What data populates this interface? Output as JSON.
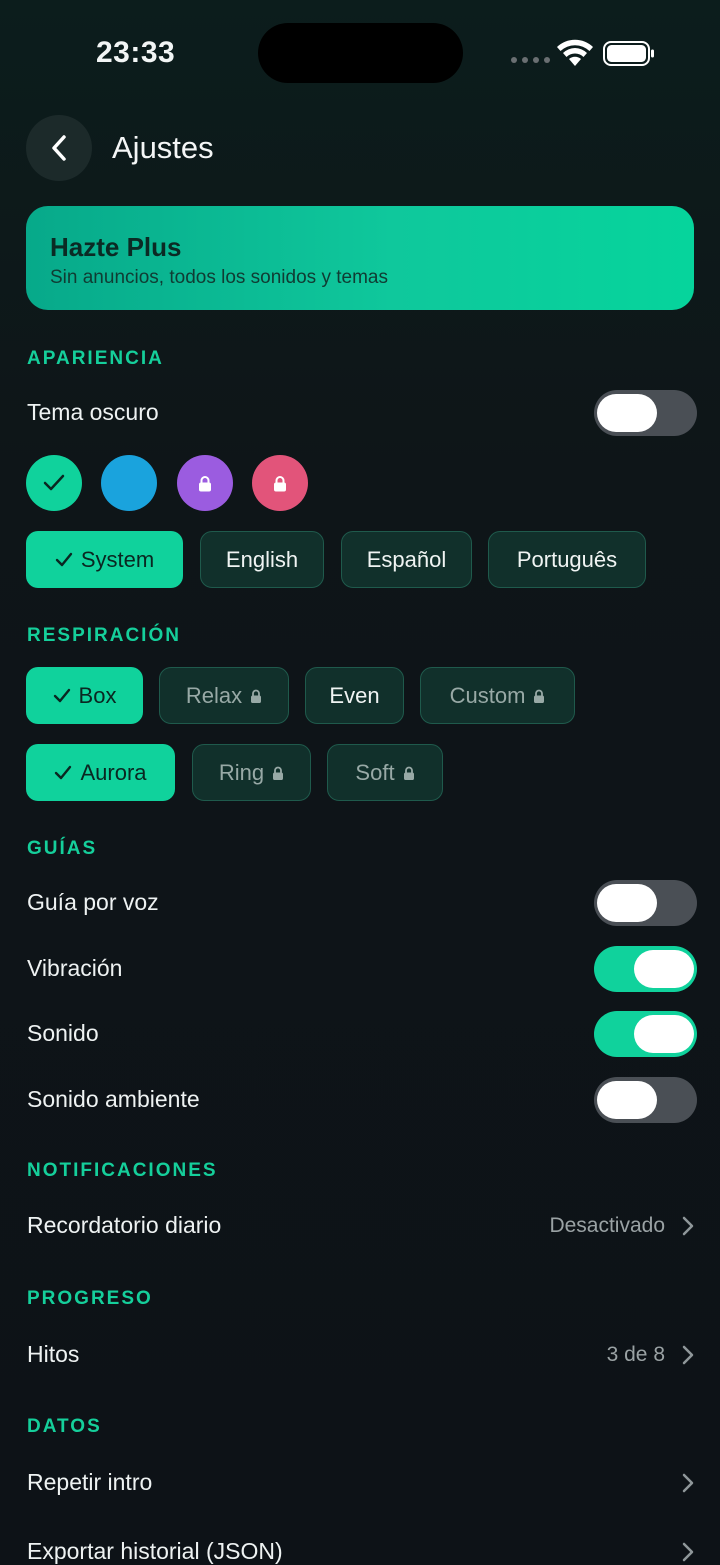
{
  "status": {
    "time": "23:33"
  },
  "header": {
    "title": "Ajustes"
  },
  "plus": {
    "title": "Hazte Plus",
    "subtitle": "Sin anuncios, todos los sonidos y temas"
  },
  "appearance": {
    "section": "APARIENCIA",
    "dark_theme_label": "Tema oscuro",
    "dark_theme_on": false,
    "swatch_colors": [
      "#10d29c",
      "#1aa3dd",
      "#9b5ce0",
      "#e2547a"
    ],
    "languages": [
      "System",
      "English",
      "Español",
      "Português"
    ],
    "selected_language": "System"
  },
  "breathing": {
    "section": "RESPIRACIÓN",
    "patterns": [
      "Box",
      "Relax",
      "Even",
      "Custom"
    ],
    "visuals": [
      "Aurora",
      "Ring",
      "Soft"
    ],
    "selected_pattern": "Box",
    "selected_visual": "Aurora"
  },
  "guides": {
    "section": "GUÍAS",
    "voice_label": "Guía por voz",
    "vibration_label": "Vibración",
    "sound_label": "Sonido",
    "ambient_label": "Sonido ambiente"
  },
  "notifications": {
    "section": "NOTIFICACIONES",
    "reminder_label": "Recordatorio diario",
    "reminder_value": "Desactivado"
  },
  "progress": {
    "section": "PROGRESO",
    "milestones_label": "Hitos",
    "milestones_value": "3 de 8"
  },
  "data": {
    "section": "DATOS",
    "replay_intro_label": "Repetir intro",
    "export_label": "Exportar historial (JSON)"
  },
  "colors": {
    "accent": "#10d29c",
    "background": "#0d1217"
  }
}
